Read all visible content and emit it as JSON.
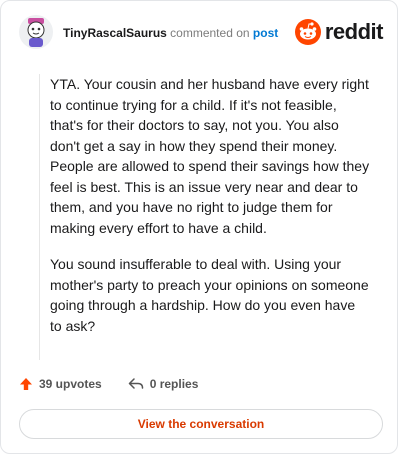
{
  "header": {
    "username": "TinyRascalSaurus",
    "meta_text": "commented on",
    "post_link": "post",
    "brand": "reddit",
    "brand_color": "#ff4500"
  },
  "comment": {
    "paragraphs": [
      "YTA. Your cousin and her husband have every right to continue trying for a child. If it's not feasible, that's for their doctors to say, not you. You also don't get a say in how they spend their money. People are allowed to spend their savings how they feel is best. This is an issue very near and dear to them, and you have no right to judge them for making every effort to have a child.",
      "You sound insufferable to deal with. Using your mother's party to preach your opinions on someone going through a hardship. How do you even have to ask?"
    ]
  },
  "actions": {
    "upvotes": "39 upvotes",
    "replies": "0 replies",
    "upvote_icon": "upvote-arrow-icon",
    "reply_icon": "reply-arrow-icon",
    "upvote_color": "#ff4500"
  },
  "cta": {
    "label": "View the conversation",
    "color": "#d93a00"
  }
}
